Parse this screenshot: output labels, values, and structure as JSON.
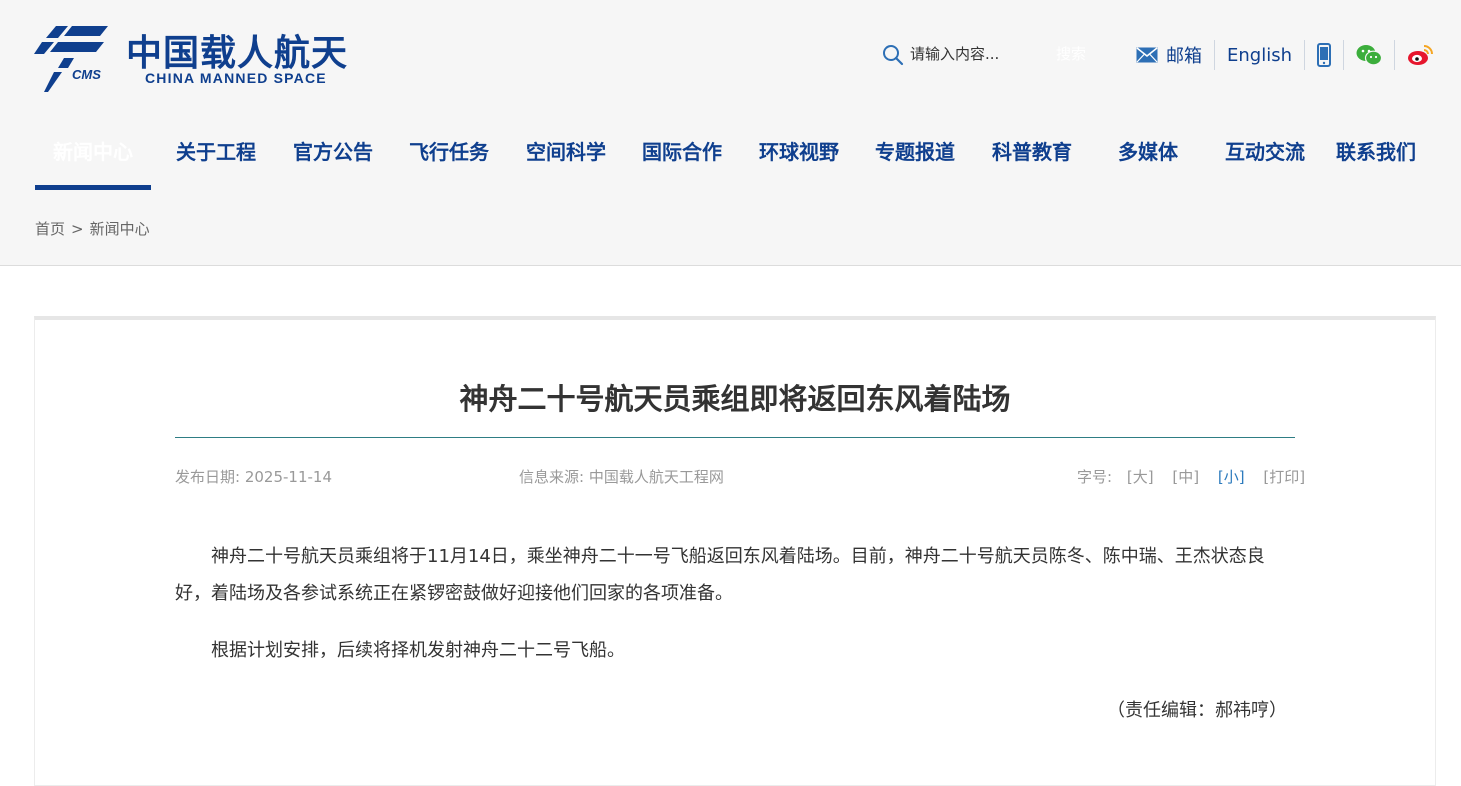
{
  "header": {
    "logo_cn": "中国载人航天",
    "logo_en": "CHINA MANNED SPACE",
    "logo_mark_text": "CMS",
    "search": {
      "placeholder": "请输入内容...",
      "button": "搜索"
    },
    "tools": {
      "mail": "邮箱",
      "english": "English"
    }
  },
  "nav": {
    "items": [
      {
        "label": "新闻中心",
        "active": true
      },
      {
        "label": "关于工程"
      },
      {
        "label": "官方公告"
      },
      {
        "label": "飞行任务"
      },
      {
        "label": "空间科学"
      },
      {
        "label": "国际合作"
      },
      {
        "label": "环球视野"
      },
      {
        "label": "专题报道"
      },
      {
        "label": "科普教育"
      },
      {
        "label": "多媒体"
      },
      {
        "label": "互动交流"
      },
      {
        "label": "联系我们"
      }
    ]
  },
  "breadcrumb": {
    "home": "首页",
    "separator": ">",
    "current": "新闻中心"
  },
  "article": {
    "title": "神舟二十号航天员乘组即将返回东风着陆场",
    "date": "发布日期: 2025-11-14",
    "source": "信息来源: 中国载人航天工程网",
    "font_size": {
      "label": "字号:",
      "large": "[大]",
      "medium": "[中]",
      "small": "[小]",
      "print": "[打印]",
      "selected": "small"
    },
    "paragraphs": [
      "神舟二十号航天员乘组将于11月14日，乘坐神舟二十一号飞船返回东风着陆场。目前，神舟二十号航天员陈冬、陈中瑞、王杰状态良好，着陆场及各参试系统正在紧锣密鼓做好迎接他们回家的各项准备。",
      "根据计划安排，后续将择机发射神舟二十二号飞船。"
    ],
    "editor": "（责任编辑：郝祎哼）"
  },
  "colors": {
    "brand": "#0f3f8e",
    "accent": "#2e7d84",
    "link_active": "#2d7bbd"
  },
  "icons": [
    "search-icon",
    "mail-icon",
    "mobile-icon",
    "wechat-icon",
    "weibo-icon"
  ]
}
